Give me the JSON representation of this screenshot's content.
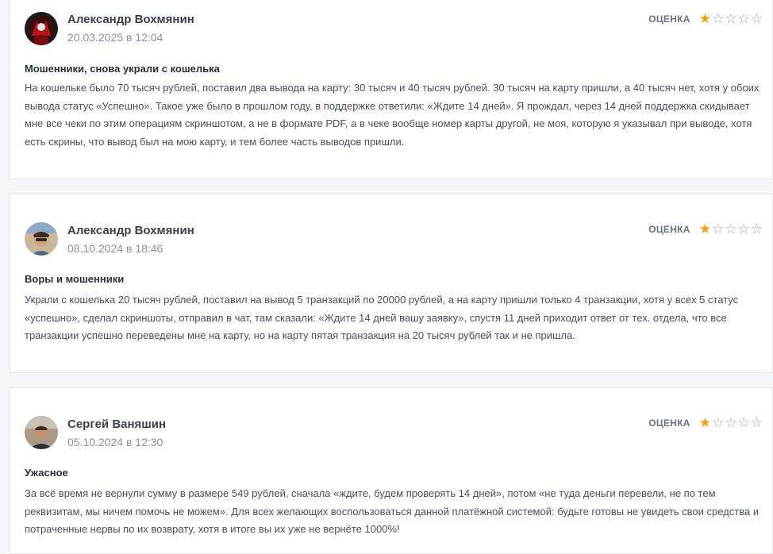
{
  "reviews": [
    {
      "author": "Александр Вохмянин",
      "date": "20.03.2025 в 12:04",
      "rating_label": "ОЦЕНКА",
      "rating": 1,
      "rating_max": 5,
      "title": "Мошенники, снова украли с кошелька",
      "text": "На кошельке было 70 тысяч рублей, поставил два вывода на карту: 30 тысяч и 40 тысяч рублей. 30 тысяч на карту пришли, а 40 тысяч нет, хотя у обоих вывода статус «Успешно». Такое уже было в прошлом году, в поддержке ответили: «Ждите 14 дней». Я прождал, через 14 дней поддержка скидывает мне все чеки по этим операциям скриншотом, а не в формате PDF, а в чеке вообще номер карты другой, не моя, которую я указывал при выводе, хотя есть скрины, что вывод был на мою карту, и тем более часть выводов пришли."
    },
    {
      "author": "Александр Вохмянин",
      "date": "08.10.2024 в 18:46",
      "rating_label": "ОЦЕНКА",
      "rating": 1,
      "rating_max": 5,
      "title": "Воры и мошенники",
      "text": "Украли с кошелька 20 тысяч рублей, поставил на вывод 5 транзакций по 20000 рублей, а на карту пришли только 4 транзакции, хотя у всех 5 статус «успешно», сделал скриншоты, отправил в чат, там сказали: «Ждите 14 дней вашу заявку», спустя 11 дней приходит ответ от тех. отдела, что все транзакции успешно переведены мне на карту, но на карту пятая транзакция на 20 тысяч рублей так и не пришла."
    },
    {
      "author": "Сергей Ваняшин",
      "date": "05.10.2024 в 12:30",
      "rating_label": "ОЦЕНКА",
      "rating": 1,
      "rating_max": 5,
      "title": "Ужасное",
      "text": "За всё время не вернули сумму в размере 549 рублей, сначала «ждите, будем проверять 14 дней», потом «не туда деньги перевели, не по тем реквизитам, мы ничем помочь не можем». Для всех желающих воспользоваться данной платёжной системой: будьте готовы не увидеть свои средства и потраченные нервы по их возврату, хотя в итоге вы их уже не вернёте 1000%!"
    }
  ],
  "colors": {
    "star_filled": "#f59e0b",
    "star_empty": "#a0a6b0",
    "date": "#8a92a0"
  }
}
